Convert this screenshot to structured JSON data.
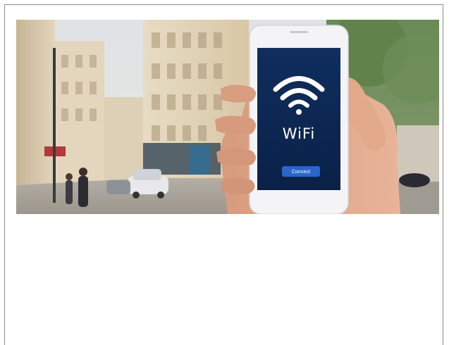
{
  "hero_image": {
    "alt": "",
    "phone_screen": {
      "title": "WiFi",
      "button_label": "Connect",
      "screen_color": "#0d2a58",
      "button_color": "#2a66c9"
    }
  },
  "colors": {
    "frame_border": "#8a8a8a",
    "background": "#ffffff"
  }
}
